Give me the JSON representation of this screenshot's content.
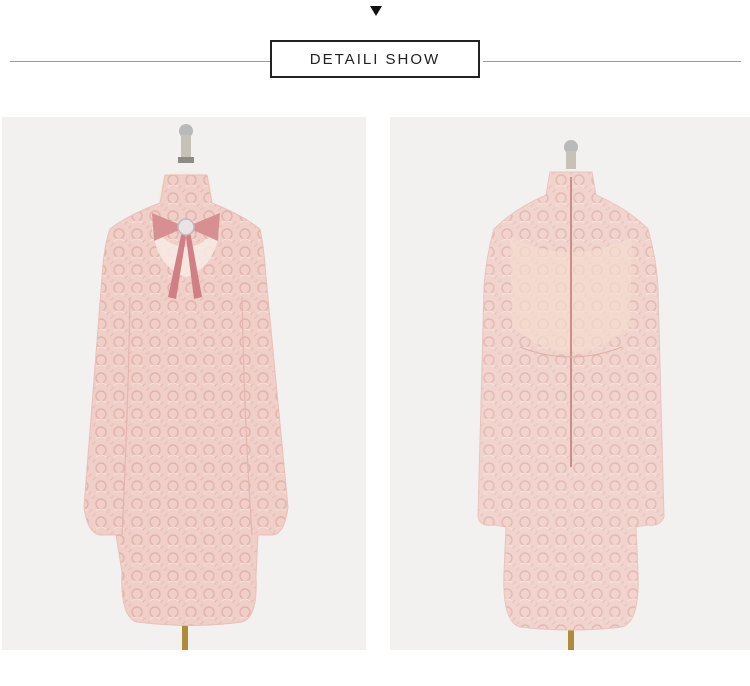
{
  "header": {
    "arrow_icon": "triangle-down-icon",
    "title": "DETAILI SHOW"
  },
  "photos": [
    {
      "name": "dress-front-photo",
      "view": "front",
      "dress_color": "#f0cfc9",
      "bow_color": "#d88f92"
    },
    {
      "name": "dress-back-photo",
      "view": "back",
      "dress_color": "#f1d4ce"
    }
  ]
}
